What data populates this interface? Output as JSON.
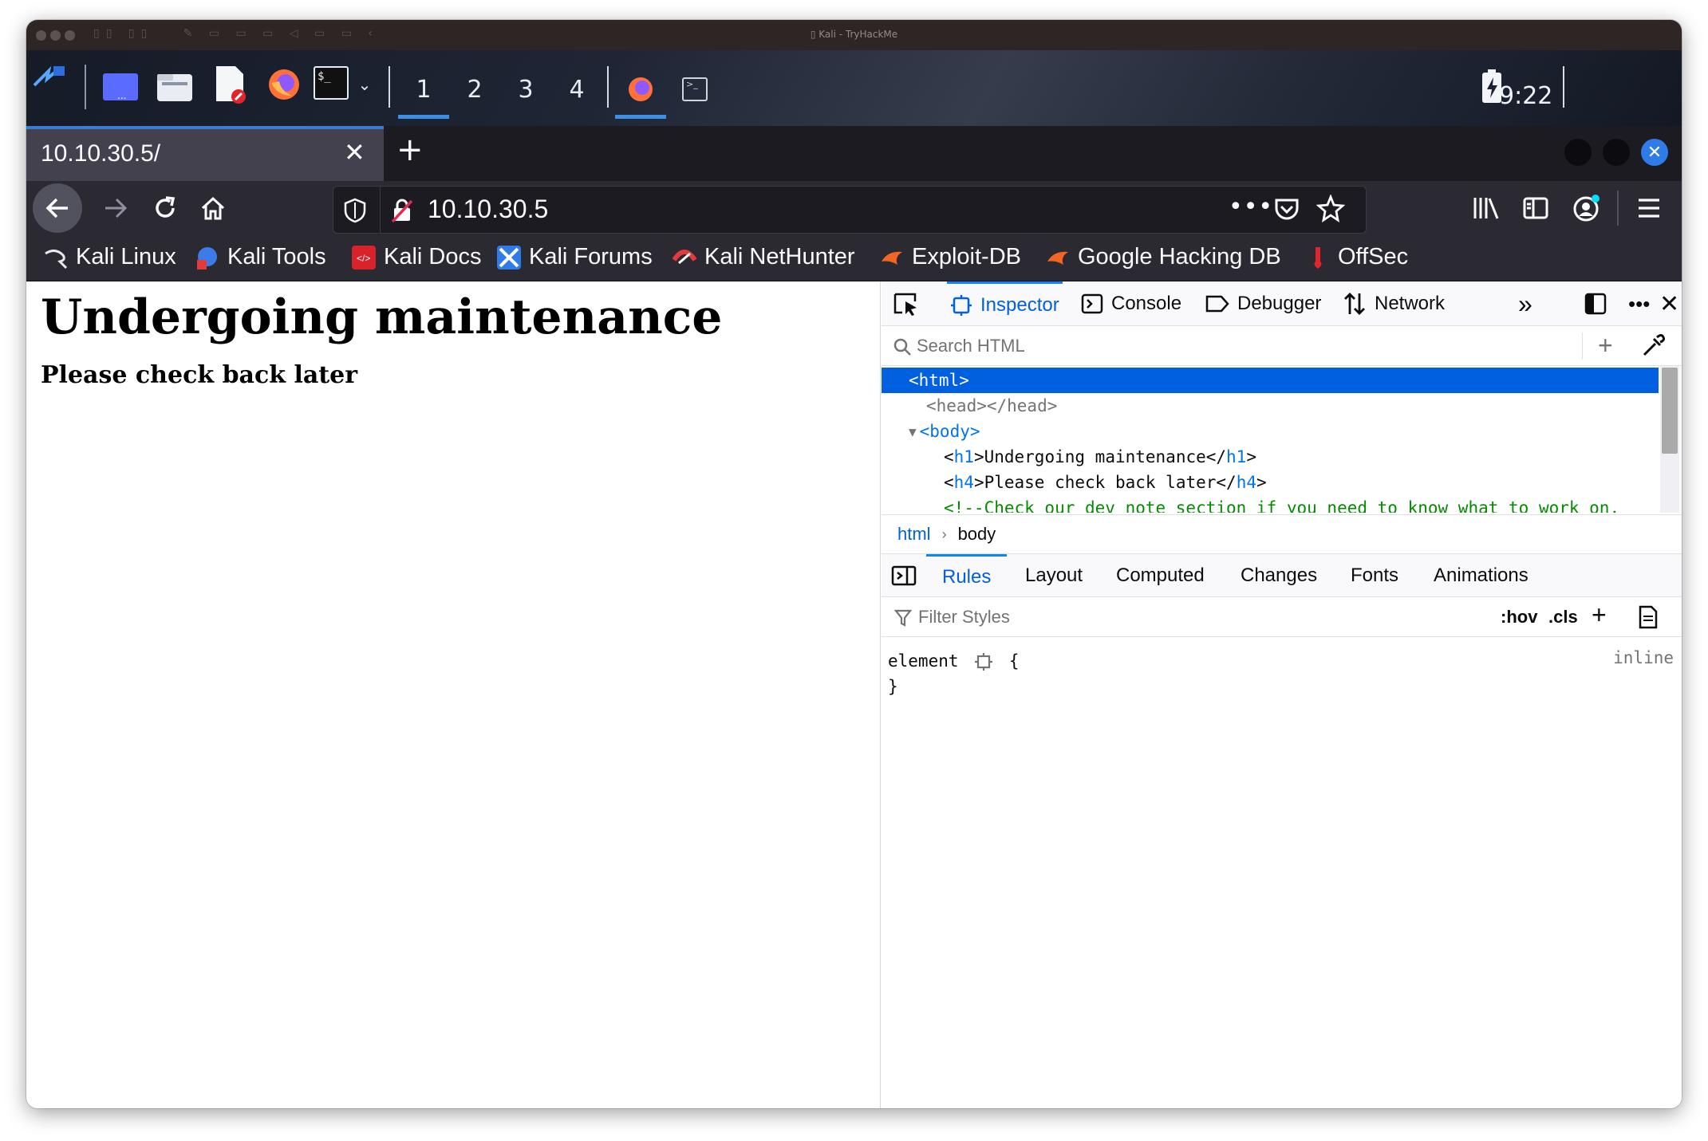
{
  "mac_window": {
    "title": "Kali - TryHackMe"
  },
  "panel": {
    "workspaces": [
      "1",
      "2",
      "3",
      "4"
    ],
    "active_workspace": "1",
    "clock": "9:22",
    "icons": [
      "kali-menu-icon",
      "show-desktop-icon",
      "file-manager-icon",
      "text-editor-icon",
      "firefox-icon",
      "terminal-icon",
      "chevron-down-icon",
      "battery-icon"
    ]
  },
  "browser": {
    "tab_title": "10.10.30.5/",
    "url": "10.10.30.5",
    "bookmarks": [
      "Kali Linux",
      "Kali Tools",
      "Kali Docs",
      "Kali Forums",
      "Kali NetHunter",
      "Exploit-DB",
      "Google Hacking DB",
      "OffSec"
    ],
    "accent": "#0060df"
  },
  "page": {
    "heading": "Undergoing maintenance",
    "subheading": "Please check back later"
  },
  "devtools": {
    "tabs": [
      "Inspector",
      "Console",
      "Debugger",
      "Network"
    ],
    "active_tab": "Inspector",
    "search_placeholder": "Search HTML",
    "tree": {
      "html": "<html>",
      "head": "<head></head>",
      "body_open": "<body>",
      "h1_open": "<",
      "h1_tag": "h1",
      "h1_text": ">Undergoing maintenance</",
      "h1_close": "h1",
      "h1_end": ">",
      "h4_open": "<",
      "h4_tag": "h4",
      "h4_text": ">Please check back later</",
      "h4_close": "h4",
      "h4_end": ">",
      "comment": "<!--Check our dev note section if you need to know what to work on."
    },
    "breadcrumbs": [
      "html",
      "body"
    ],
    "rule_tabs": [
      "Rules",
      "Layout",
      "Computed",
      "Changes",
      "Fonts",
      "Animations"
    ],
    "active_rule_tab": "Rules",
    "filter_placeholder": "Filter Styles",
    "hov": ":hov",
    "cls": ".cls",
    "rule_selector": "element",
    "rule_open": "{",
    "rule_close": "}",
    "rule_source": "inline"
  }
}
